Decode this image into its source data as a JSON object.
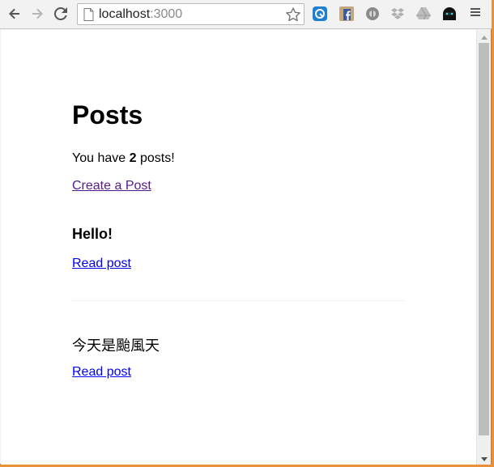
{
  "browser": {
    "url_host": "localhost",
    "url_port": ":3000"
  },
  "page": {
    "title": "Posts",
    "count_prefix": "You have ",
    "count_value": "2",
    "count_suffix": " posts!",
    "create_link": "Create a Post",
    "posts": [
      {
        "title": "Hello!",
        "link": "Read post"
      },
      {
        "title": "今天是颱風天",
        "link": "Read post"
      }
    ]
  },
  "colors": {
    "visited_link": "#551a8b",
    "link": "#0000ee",
    "frame_accent": "#e8903a"
  },
  "icons": [
    "back-arrow-icon",
    "forward-arrow-icon",
    "reload-icon",
    "page-icon",
    "star-icon",
    "menu-icon"
  ]
}
